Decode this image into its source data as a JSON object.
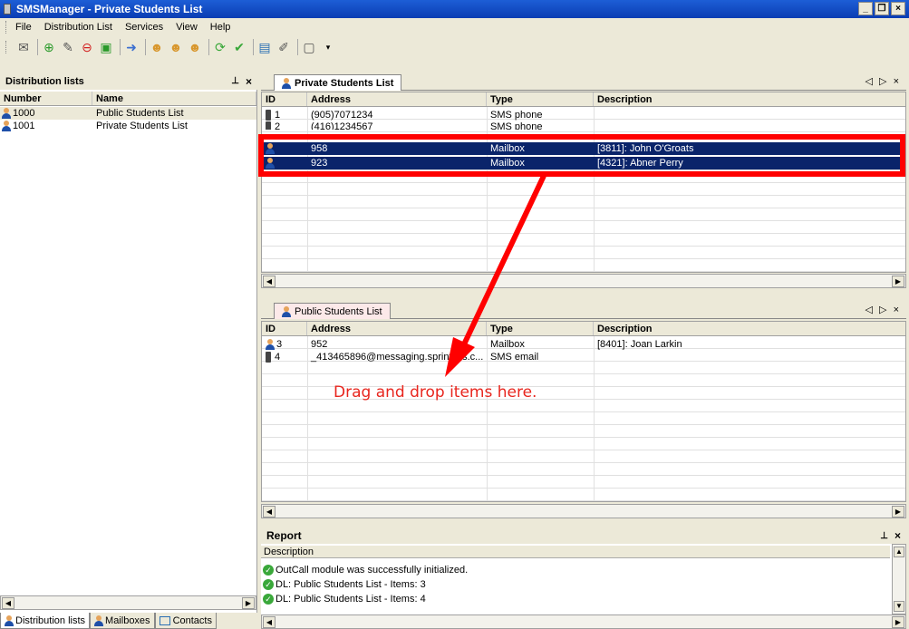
{
  "window": {
    "title": "SMSManager - Private Students List"
  },
  "menu": [
    "File",
    "Distribution List",
    "Services",
    "View",
    "Help"
  ],
  "toolbar_icons": [
    "envelope-icon",
    "add-icon",
    "edit-icon",
    "delete-icon",
    "export-icon",
    "move-icon",
    "group-icon",
    "group-add-icon",
    "group-remove-icon",
    "send-icon",
    "check-icon",
    "report-icon",
    "compose-icon",
    "page-icon"
  ],
  "left_panel": {
    "title": "Distribution lists",
    "columns": [
      "Number",
      "Name"
    ],
    "rows": [
      {
        "number": "1000",
        "name": "Public Students List"
      },
      {
        "number": "1001",
        "name": "Private Students List"
      }
    ],
    "tabs": [
      "Distribution lists",
      "Mailboxes",
      "Contacts"
    ]
  },
  "private_list": {
    "tab": "Private Students List",
    "columns": [
      "ID",
      "Address",
      "Type",
      "Description"
    ],
    "rows": [
      {
        "id": "1",
        "address": "(905)7071234",
        "type": "SMS phone",
        "description": ""
      },
      {
        "id": "2",
        "address": "(416)1234567",
        "type": "SMS phone",
        "description": ""
      },
      {
        "id": "",
        "address": "958",
        "type": "Mailbox",
        "description": "[3811]: John O'Groats"
      },
      {
        "id": "",
        "address": "923",
        "type": "Mailbox",
        "description": "[4321]: Abner Perry"
      }
    ]
  },
  "public_list": {
    "tab": "Public Students List",
    "columns": [
      "ID",
      "Address",
      "Type",
      "Description"
    ],
    "rows": [
      {
        "id": "3",
        "address": "952",
        "type": "Mailbox",
        "description": "[8401]: Joan Larkin"
      },
      {
        "id": "4",
        "address": "_413465896@messaging.sprintpcs.c...",
        "type": "SMS email",
        "description": ""
      }
    ]
  },
  "annotation": {
    "text": "Drag and drop items here.",
    "color": "#ff0000"
  },
  "report": {
    "title": "Report",
    "column": "Description",
    "lines": [
      "OutCall module was successfully initialized.",
      "DL: Public Students List - Items: 3",
      "DL: Public Students List - Items: 4"
    ]
  },
  "colors": {
    "selection": "#0a246a",
    "accent": "#1d5ed6"
  }
}
